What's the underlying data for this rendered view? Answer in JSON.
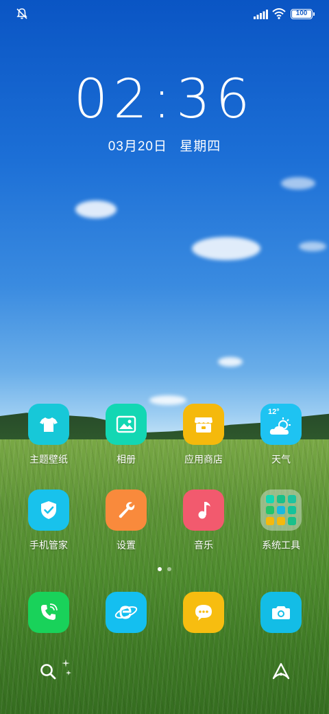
{
  "status_bar": {
    "battery_level": "100",
    "icons": [
      "mute-icon",
      "signal-icon",
      "wifi-icon",
      "battery-icon"
    ]
  },
  "clock": {
    "time": "02:36",
    "date": "03月20日",
    "weekday": "星期四"
  },
  "home_apps": [
    {
      "label": "主题壁纸",
      "icon": "tshirt-icon",
      "color": "#17c8d8"
    },
    {
      "label": "相册",
      "icon": "gallery-icon",
      "color": "#13d7b3"
    },
    {
      "label": "应用商店",
      "icon": "store-icon",
      "color": "#f5b90c"
    },
    {
      "label": "天气",
      "icon": "weather-icon",
      "color": "#1ec3f2",
      "temp": "12°"
    },
    {
      "label": "手机管家",
      "icon": "shield-icon",
      "color": "#18c2ec"
    },
    {
      "label": "设置",
      "icon": "wrench-icon",
      "color": "#f98a3c"
    },
    {
      "label": "音乐",
      "icon": "music-note-icon",
      "color": "#f25a6e"
    },
    {
      "label": "系统工具",
      "icon": "folder-icon",
      "color": "rgba(200,220,200,0.55)"
    }
  ],
  "page_indicator": {
    "pages": 2,
    "current": 1
  },
  "dock": [
    {
      "name": "phone",
      "icon": "phone-icon",
      "color": "#19d25a"
    },
    {
      "name": "browser",
      "icon": "browser-icon",
      "color": "#14bff0"
    },
    {
      "name": "messages",
      "icon": "message-icon",
      "color": "#f7bd10"
    },
    {
      "name": "camera",
      "icon": "camera-icon",
      "color": "#13bde6"
    }
  ],
  "bottom_bar": {
    "icons": [
      "search-icon",
      "sparkle-icon",
      "assistant-icon"
    ]
  }
}
